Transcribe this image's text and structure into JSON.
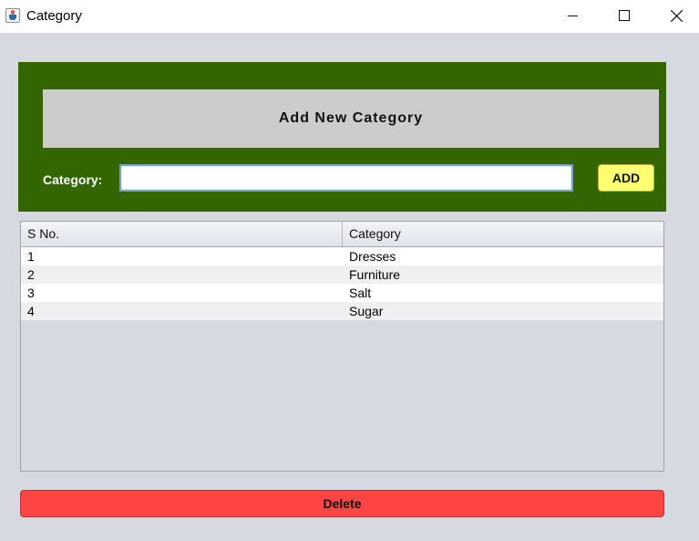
{
  "window": {
    "title": "Category",
    "app_icon": "java-cup-icon",
    "controls": [
      "minimize-icon",
      "maximize-icon",
      "close-icon"
    ]
  },
  "header": {
    "heading": "Add New Category",
    "panel_color": "#336600"
  },
  "form": {
    "category_label": "Category:",
    "category_value": "",
    "add_label": "ADD",
    "add_color": "#ffff73"
  },
  "table": {
    "columns": [
      "S No.",
      "Category"
    ],
    "rows": [
      {
        "sno": "1",
        "category": "Dresses"
      },
      {
        "sno": "2",
        "category": "Furniture"
      },
      {
        "sno": "3",
        "category": "Salt"
      },
      {
        "sno": "4",
        "category": "Sugar"
      }
    ]
  },
  "actions": {
    "delete_label": "Delete",
    "delete_color": "#ff4444"
  }
}
